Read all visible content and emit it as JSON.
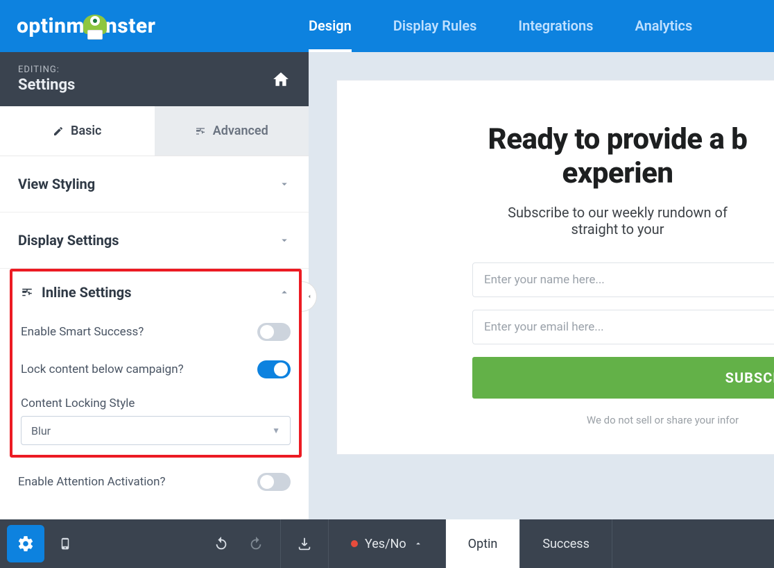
{
  "brand": {
    "name": "optinmonster",
    "prefix": "optinm",
    "suffix": "nster"
  },
  "nav": {
    "items": [
      {
        "label": "Design",
        "active": true
      },
      {
        "label": "Display Rules",
        "active": false
      },
      {
        "label": "Integrations",
        "active": false
      },
      {
        "label": "Analytics",
        "active": false
      }
    ]
  },
  "editing": {
    "prefix": "EDITING:",
    "title": "Settings"
  },
  "tabs": {
    "basic": "Basic",
    "advanced": "Advanced",
    "active": "basic"
  },
  "sections": {
    "view_styling": "View Styling",
    "display_settings": "Display Settings",
    "inline_settings": "Inline Settings"
  },
  "inline": {
    "smart_success": {
      "label": "Enable Smart Success?",
      "value": false
    },
    "lock_content": {
      "label": "Lock content below campaign?",
      "value": true
    },
    "locking_style": {
      "label": "Content Locking Style",
      "value": "Blur"
    },
    "attention": {
      "label": "Enable Attention Activation?",
      "value": false
    }
  },
  "preview": {
    "headline_line1": "Ready to provide a b",
    "headline_line2": "experien",
    "sub_line1": "Subscribe to our weekly rundown of",
    "sub_line2": "straight to your",
    "name_placeholder": "Enter your name here...",
    "email_placeholder": "Enter your email here...",
    "cta": "SUBSCRIBE",
    "disclaimer": "We do not sell or share your infor"
  },
  "footer": {
    "yesno": "Yes/No",
    "optin": "Optin",
    "success": "Success"
  },
  "colors": {
    "brand_blue": "#0d82df",
    "sidebar_dark": "#3a434f",
    "cta_green": "#63b148",
    "highlight_red": "#ec1b23"
  }
}
